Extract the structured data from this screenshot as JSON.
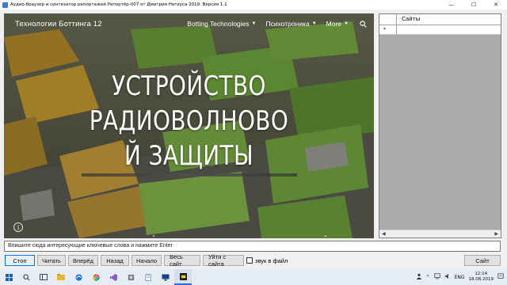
{
  "window": {
    "title": "Аудио-браузер и синтезатор репортажей Репортёр-007 от Дмитрия Негиуса 2019.  Версия 1.1",
    "controls": [
      "—",
      "☐",
      "✕"
    ]
  },
  "browser": {
    "brand": "Технологии Боттинга 12",
    "nav": [
      {
        "label": "Botting Technologies",
        "has_caret": true
      },
      {
        "label": "Психотроника",
        "has_caret": true
      },
      {
        "label": "More",
        "has_caret": true
      }
    ],
    "headline": [
      "УСТРОЙСТВО",
      "РАДИОВОЛНОВО",
      "Й ЗАЩИТЫ"
    ],
    "info_glyph": "i",
    "scroll_glyph": "⌄"
  },
  "grid": {
    "column": "Сайты",
    "row_marker": "*",
    "scroll_left": "◀",
    "scroll_right": "▶"
  },
  "search": {
    "value": "Впишите сюда интересующие ключевые слова и нажмите Enter"
  },
  "buttons": {
    "stop": "Стоп",
    "read": "Читать",
    "forward": "Вперёд",
    "back": "Назад",
    "start": "Начало",
    "whole_site": "Весь сайт",
    "leave_site": "Уйти с сайта",
    "sound_to_file": "звук в файл",
    "site": "Сайт"
  },
  "taskbar": {
    "lang": "ENG",
    "time": "12:14",
    "date": "18.08.2019"
  },
  "colors": {
    "accent": "#0078d7",
    "grid_bg": "#ababab",
    "taskbar_bg": "#e6ecf4"
  }
}
